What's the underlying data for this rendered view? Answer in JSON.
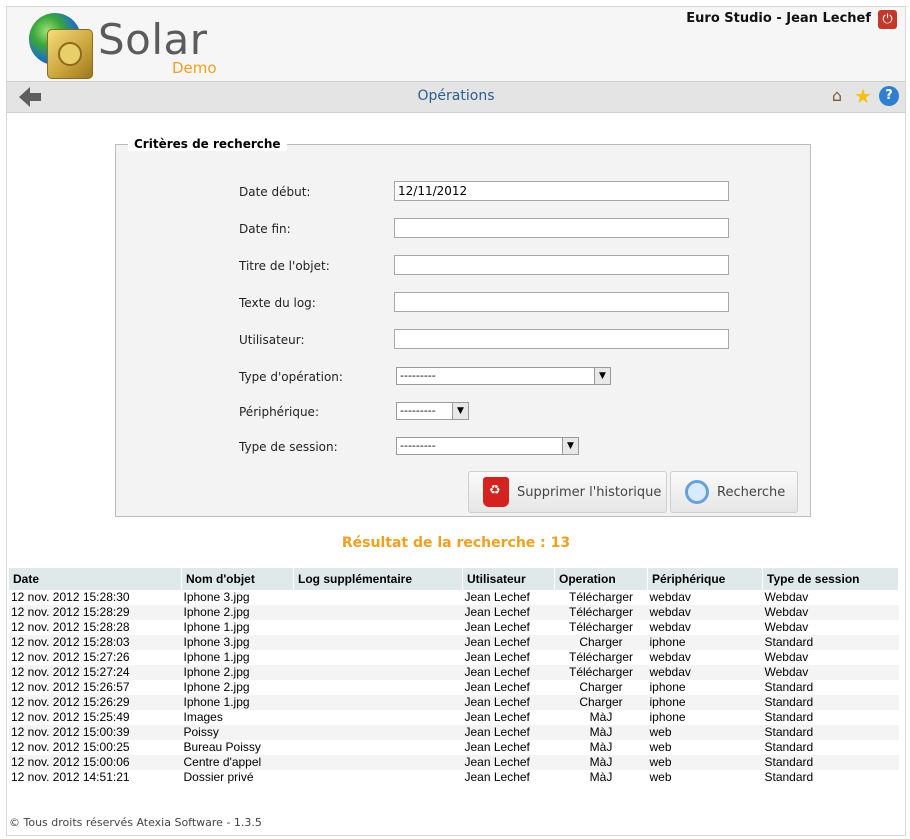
{
  "header": {
    "logo_text": "Solar",
    "logo_sub": "Demo",
    "user_label": "Euro Studio - Jean Lechef",
    "power_icon": "power-icon"
  },
  "navbar": {
    "title": "Opérations",
    "icons": [
      "back-arrow-icon",
      "home-icon",
      "star-icon",
      "help-icon"
    ]
  },
  "criteria": {
    "legend": "Critères de recherche",
    "fields": {
      "date_debut": {
        "label": "Date début:",
        "value": "12/11/2012"
      },
      "date_fin": {
        "label": "Date fin:",
        "value": ""
      },
      "titre_objet": {
        "label": "Titre de l'objet:",
        "value": ""
      },
      "texte_log": {
        "label": "Texte du log:",
        "value": ""
      },
      "utilisateur": {
        "label": "Utilisateur:",
        "value": ""
      },
      "type_operation": {
        "label": "Type d'opération:",
        "value": "---------"
      },
      "peripherique": {
        "label": "Périphérique:",
        "value": "---------"
      },
      "type_session": {
        "label": "Type de session:",
        "value": "---------"
      }
    },
    "buttons": {
      "delete": "Supprimer l'historique",
      "search": "Recherche"
    }
  },
  "results": {
    "title": "Résultat de la recherche : 13",
    "columns": [
      "Date",
      "Nom d'objet",
      "Log supplémentaire",
      "Utilisateur",
      "Operation",
      "Périphérique",
      "Type de session"
    ],
    "rows": [
      [
        "12 nov. 2012 15:28:30",
        "Iphone 3.jpg",
        "",
        "Jean Lechef",
        "Télécharger",
        "webdav",
        "Webdav"
      ],
      [
        "12 nov. 2012 15:28:29",
        "Iphone 2.jpg",
        "",
        "Jean Lechef",
        "Télécharger",
        "webdav",
        "Webdav"
      ],
      [
        "12 nov. 2012 15:28:28",
        "Iphone 1.jpg",
        "",
        "Jean Lechef",
        "Télécharger",
        "webdav",
        "Webdav"
      ],
      [
        "12 nov. 2012 15:28:03",
        "Iphone 3.jpg",
        "",
        "Jean Lechef",
        "Charger",
        "iphone",
        "Standard"
      ],
      [
        "12 nov. 2012 15:27:26",
        "Iphone 1.jpg",
        "",
        "Jean Lechef",
        "Télécharger",
        "webdav",
        "Webdav"
      ],
      [
        "12 nov. 2012 15:27:24",
        "Iphone 2.jpg",
        "",
        "Jean Lechef",
        "Télécharger",
        "webdav",
        "Webdav"
      ],
      [
        "12 nov. 2012 15:26:57",
        "Iphone 2.jpg",
        "",
        "Jean Lechef",
        "Charger",
        "iphone",
        "Standard"
      ],
      [
        "12 nov. 2012 15:26:29",
        "Iphone 1.jpg",
        "",
        "Jean Lechef",
        "Charger",
        "iphone",
        "Standard"
      ],
      [
        "12 nov. 2012 15:25:49",
        "Images",
        "",
        "Jean Lechef",
        "MàJ",
        "iphone",
        "Standard"
      ],
      [
        "12 nov. 2012 15:00:39",
        "Poissy",
        "",
        "Jean Lechef",
        "MàJ",
        "web",
        "Standard"
      ],
      [
        "12 nov. 2012 15:00:25",
        "Bureau Poissy",
        "",
        "Jean Lechef",
        "MàJ",
        "web",
        "Standard"
      ],
      [
        "12 nov. 2012 15:00:06",
        "Centre d'appel",
        "",
        "Jean Lechef",
        "MàJ",
        "web",
        "Standard"
      ],
      [
        "12 nov. 2012 14:51:21",
        "Dossier privé",
        "",
        "Jean Lechef",
        "MàJ",
        "web",
        "Standard"
      ]
    ]
  },
  "footer": {
    "text": "© Tous droits réservés Atexia Software - 1.3.5"
  },
  "colors": {
    "accent": "#f0a020",
    "nav_title": "#2a5f8f",
    "table_header": "#dfe9e9"
  }
}
